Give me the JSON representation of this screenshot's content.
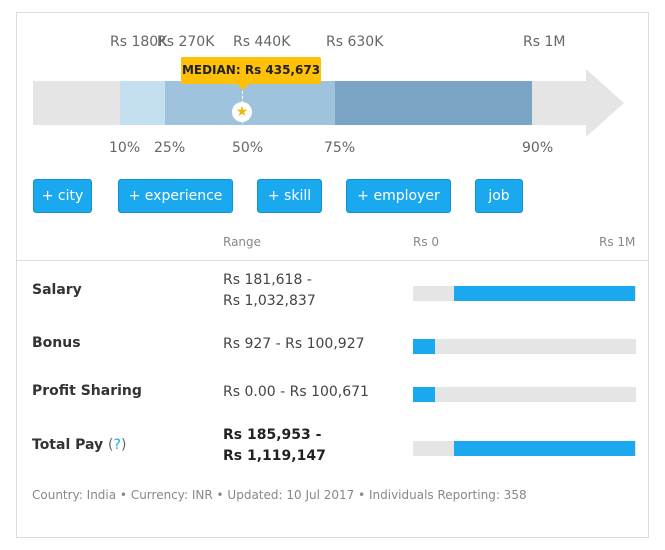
{
  "scale": {
    "top_labels": [
      "Rs 180K",
      "Rs 270K",
      "Rs 440K",
      "Rs 630K",
      "Rs 1M"
    ],
    "bottom_labels": [
      "10%",
      "25%",
      "50%",
      "75%",
      "90%"
    ],
    "median_label": "MEDIAN: Rs 435,673",
    "median_icon": "star-icon",
    "colors": {
      "p10_p25": "#c4dff0",
      "p25_p50": "#9fc3dd",
      "p50_p75": "#9fc3dd",
      "p75_p90": "#7aa4c4",
      "track": "#e5e5e5",
      "median_tag": "#ffc107"
    }
  },
  "filters": [
    "+ city",
    "+ experience",
    "+ skill",
    "+ employer",
    "job"
  ],
  "table": {
    "range_header": "Range",
    "scale_min": "Rs 0",
    "scale_max": "Rs 1M",
    "rows": [
      {
        "label": "Salary",
        "range_line1": "Rs 181,618 -",
        "range_line2": "Rs 1,032,837",
        "min": 181618,
        "max": 1032837
      },
      {
        "label": "Bonus",
        "range_line1": "Rs 927 - Rs 100,927",
        "min": 927,
        "max": 100927
      },
      {
        "label": "Profit Sharing",
        "range_line1": "Rs 0.00 - Rs 100,671",
        "min": 0,
        "max": 100671
      },
      {
        "label": "Total Pay",
        "help": "?",
        "range_line1": "Rs 185,953 -",
        "range_line2": "Rs 1,119,147",
        "min": 185953,
        "max": 1119147
      }
    ]
  },
  "footer": "Country: India • Currency: INR • Updated: 10 Jul 2017 • Individuals Reporting: 358",
  "accent_color": "#1aa9ef"
}
